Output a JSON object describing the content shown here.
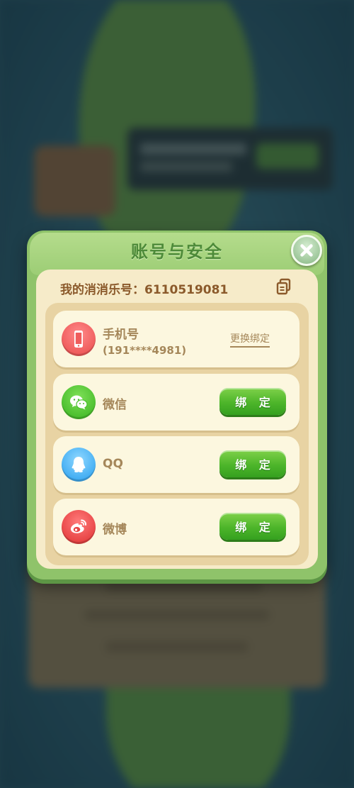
{
  "dialog": {
    "title": "账号与安全",
    "account_label": "我的消消乐号：",
    "account_id": "6110519081"
  },
  "rows": [
    {
      "name": "phone",
      "label": "手机号",
      "value": "(191****4981)",
      "action": "更换绑定",
      "icon": "phone-icon"
    },
    {
      "name": "wechat",
      "label": "微信",
      "action": "绑 定",
      "icon": "wechat-icon"
    },
    {
      "name": "qq",
      "label": "QQ",
      "action": "绑 定",
      "icon": "qq-icon"
    },
    {
      "name": "weibo",
      "label": "微博",
      "action": "绑 定",
      "icon": "weibo-icon"
    }
  ],
  "colors": {
    "dialog_green": "#8fc36a",
    "title_green": "#4d8a39",
    "panel_cream": "#f6ebc9",
    "text_brown": "#8b5a2b",
    "button_green": "#4db52a"
  }
}
